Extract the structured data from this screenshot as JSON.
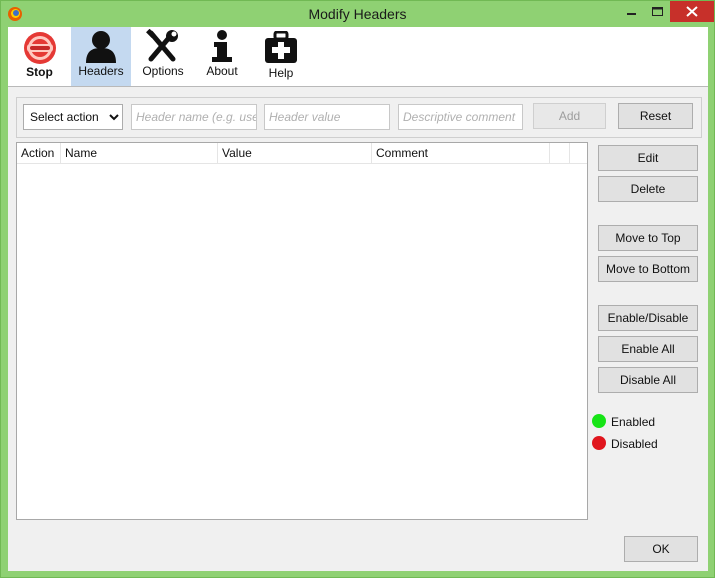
{
  "window": {
    "title": "Modify Headers"
  },
  "toolbar": {
    "stop": "Stop",
    "headers": "Headers",
    "options": "Options",
    "about": "About",
    "help": "Help"
  },
  "form": {
    "action_select": "Select action",
    "header_name_placeholder": "Header name (e.g. user-agent)",
    "header_value_placeholder": "Header value",
    "comment_placeholder": "Descriptive comment",
    "add": "Add",
    "reset": "Reset"
  },
  "table": {
    "columns": [
      "Action",
      "Name",
      "Value",
      "Comment"
    ]
  },
  "side_buttons": {
    "edit": "Edit",
    "delete": "Delete",
    "move_top": "Move to Top",
    "move_bottom": "Move to Bottom",
    "enable_disable": "Enable/Disable",
    "enable_all": "Enable All",
    "disable_all": "Disable All"
  },
  "legend": {
    "enabled": "Enabled",
    "disabled": "Disabled"
  },
  "footer": {
    "ok": "OK"
  },
  "colors": {
    "enabled": "#16e416",
    "disabled": "#e0151d",
    "titlebar": "#8fd173",
    "close": "#c7302a",
    "active_tool": "#c4d9f0"
  }
}
